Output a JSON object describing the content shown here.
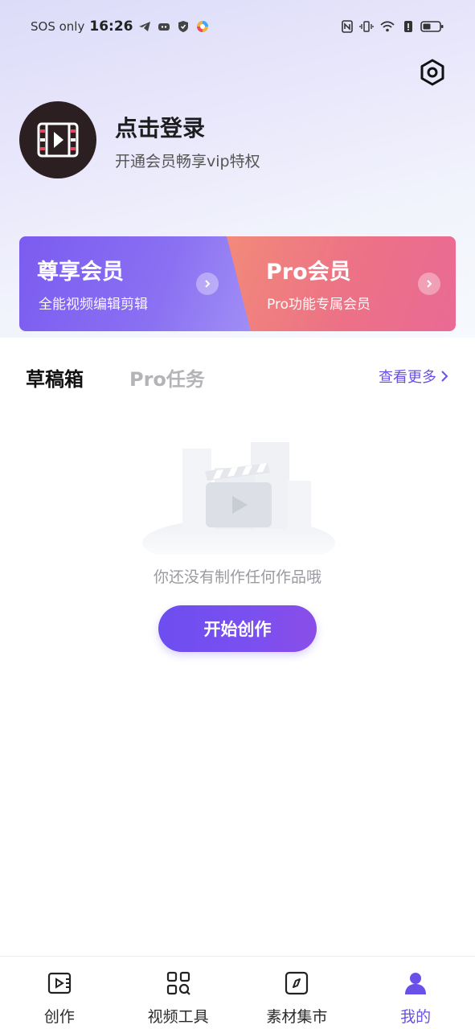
{
  "status_bar": {
    "sos": "SOS only",
    "time": "16:26",
    "battery": "battery-icon"
  },
  "header": {
    "settings_icon": "settings-hex-icon"
  },
  "profile": {
    "login_title": "点击登录",
    "login_subtitle": "开通会员畅享vip特权",
    "avatar_icon": "film-play-icon"
  },
  "membership": {
    "premium": {
      "title": "尊享会员",
      "subtitle": "全能视频编辑剪辑"
    },
    "pro": {
      "title": "Pro会员",
      "subtitle": "Pro功能专属会员"
    }
  },
  "tabs": {
    "drafts": "草稿箱",
    "pro_tasks": "Pro任务",
    "see_more": "查看更多"
  },
  "empty_state": {
    "message": "你还没有制作任何作品哦",
    "button": "开始创作"
  },
  "bottom_nav": {
    "items": [
      {
        "label": "创作",
        "icon": "create-video-icon",
        "active": false
      },
      {
        "label": "视频工具",
        "icon": "tools-grid-icon",
        "active": false
      },
      {
        "label": "素材集市",
        "icon": "compass-icon",
        "active": false
      },
      {
        "label": "我的",
        "icon": "user-icon",
        "active": true
      }
    ]
  },
  "colors": {
    "accent": "#6a4fe8",
    "premium_card": "#7b5cf0",
    "pro_card": "#ec7186"
  }
}
